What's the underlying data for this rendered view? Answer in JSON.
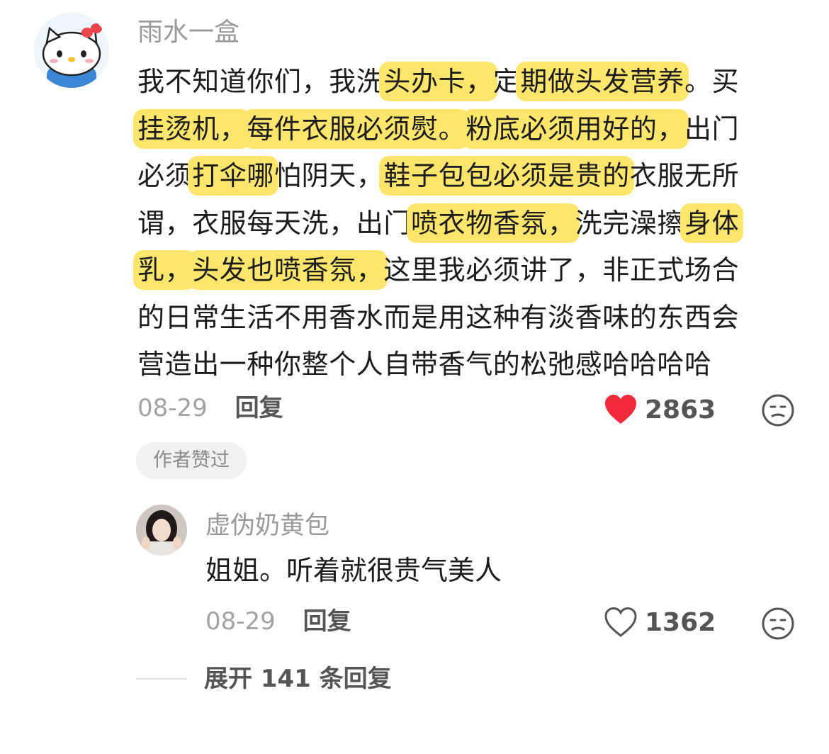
{
  "comment": {
    "username": "雨水一盒",
    "lines": [
      [
        {
          "t": "我不知道你们，我洗",
          "h": false
        },
        {
          "t": "头办卡，",
          "h": true
        },
        {
          "t": "定",
          "h": false
        },
        {
          "t": "期做头发营养",
          "h": true
        },
        {
          "t": "。买",
          "h": false
        }
      ],
      [
        {
          "t": "挂烫机，",
          "h": true
        },
        {
          "t": "每件衣服必须熨。",
          "h": true
        },
        {
          "t": "粉底必须用好的，",
          "h": true
        },
        {
          "t": "出门",
          "h": false
        }
      ],
      [
        {
          "t": "必须",
          "h": false
        },
        {
          "t": "打伞哪",
          "h": true
        },
        {
          "t": "怕阴天，",
          "h": false
        },
        {
          "t": "鞋子包包必须是贵的",
          "h": true
        },
        {
          "t": "衣服无所",
          "h": false
        }
      ],
      [
        {
          "t": "谓，衣服每天洗，出门",
          "h": false
        },
        {
          "t": "喷衣物香氛，",
          "h": true
        },
        {
          "t": "洗完澡擦",
          "h": false
        },
        {
          "t": "身体",
          "h": true
        }
      ],
      [
        {
          "t": "乳，",
          "h": true
        },
        {
          "t": "头发也喷香氛，",
          "h": true
        },
        {
          "t": "这里我必须讲了，非正式场合",
          "h": false
        }
      ],
      [
        {
          "t": "的日常生活不用香水而是用这种有淡香味的东西会",
          "h": false
        }
      ],
      [
        {
          "t": "营造出一种你整个人自带香气的松弛感哈哈哈哈",
          "h": false
        }
      ]
    ],
    "date": "08-29",
    "reply_label": "回复",
    "likes": "2863",
    "badge": "作者赞过",
    "icons": {
      "avatar": "hello-kitty-avatar-icon",
      "like": "heart-filled-icon",
      "emoji": "emoji-face-icon"
    },
    "colors": {
      "highlight": "#fde66b",
      "like": "#f02a3a"
    }
  },
  "reply": {
    "username": "虚伪奶黄包",
    "text": "姐姐。听着就很贵气美人",
    "date": "08-29",
    "reply_label": "回复",
    "likes": "1362",
    "icons": {
      "like": "heart-outline-icon",
      "emoji": "emoji-face-icon"
    }
  },
  "expand": {
    "label": "展开 141 条回复"
  }
}
